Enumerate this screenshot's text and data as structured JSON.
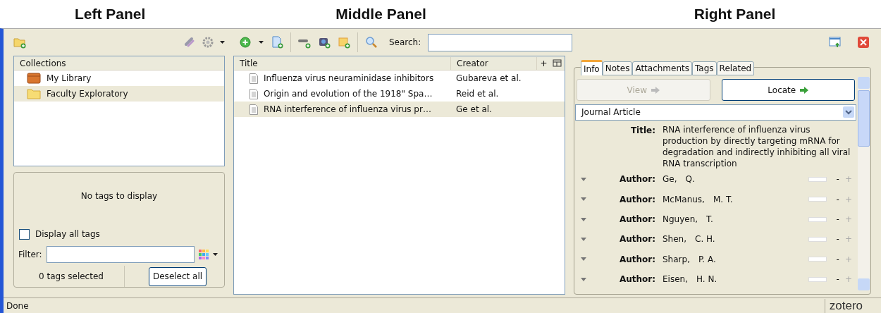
{
  "headings": [
    "Left Panel",
    "Middle Panel",
    "Right Panel"
  ],
  "collections": {
    "header": "Collections",
    "items": [
      {
        "label": "My Library",
        "kind": "library",
        "selected": false
      },
      {
        "label": "Faculty Exploratory",
        "kind": "folder",
        "selected": true
      }
    ]
  },
  "tag_selector": {
    "empty_message": "No tags to display",
    "display_all": {
      "label": "Display all tags",
      "checked": false
    },
    "filter_label": "Filter:",
    "count": "0 tags selected",
    "deselect": "Deselect all"
  },
  "search": {
    "label": "Search:"
  },
  "items_table": {
    "columns": [
      "Title",
      "Creator",
      "+"
    ],
    "rows": [
      {
        "title": "Influenza virus neuraminidase inhibitors",
        "creator": "Gubareva et al.",
        "selected": false
      },
      {
        "title": "Origin and evolution of the 1918\" Spa…",
        "creator": "Reid et al.",
        "selected": false
      },
      {
        "title": "RNA interference of influenza virus pr…",
        "creator": "Ge et al.",
        "selected": true
      }
    ]
  },
  "item_pane": {
    "tabs": [
      {
        "label": "Info",
        "selected": true
      },
      {
        "label": "Notes",
        "selected": false
      },
      {
        "label": "Attachments",
        "selected": false
      },
      {
        "label": "Tags",
        "selected": false
      },
      {
        "label": "Related",
        "selected": false
      }
    ],
    "view": {
      "label": "View",
      "disabled": true
    },
    "locate": {
      "label": "Locate",
      "disabled": false
    },
    "item_type": "Journal Article",
    "title_label": "Title:",
    "title": "RNA interference of influenza virus production by directly targeting mRNA for degradation and indirectly inhibiting all viral RNA transcription",
    "authors": [
      {
        "label": "Author:",
        "last": "Ge,",
        "first": "Q."
      },
      {
        "label": "Author:",
        "last": "McManus,",
        "first": "M. T."
      },
      {
        "label": "Author:",
        "last": "Nguyen,",
        "first": "T."
      },
      {
        "label": "Author:",
        "last": "Shen,",
        "first": "C. H."
      },
      {
        "label": "Author:",
        "last": "Sharp,",
        "first": "P. A."
      },
      {
        "label": "Author:",
        "last": "Eisen,",
        "first": "H. N."
      }
    ],
    "minus": "-",
    "plus": "+"
  },
  "status_bar": {
    "text": "Done",
    "logo": "zotero"
  }
}
